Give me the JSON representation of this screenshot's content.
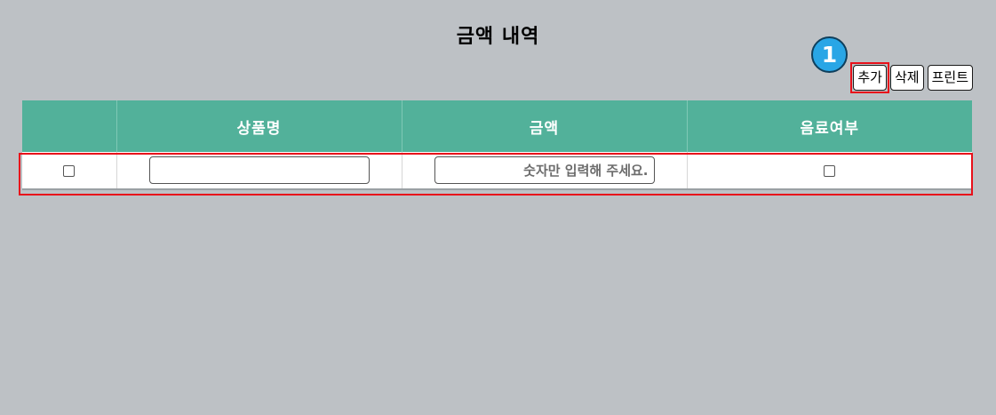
{
  "page": {
    "title": "금액 내역"
  },
  "toolbar": {
    "add_label": "추가",
    "delete_label": "삭제",
    "print_label": "프린트"
  },
  "annotation": {
    "step_number": "1"
  },
  "table": {
    "columns": [
      "",
      "상품명",
      "금액",
      "음료여부"
    ],
    "rows": [
      {
        "selected": false,
        "product_name": "",
        "amount": "",
        "amount_placeholder": "숫자만 입력해 주세요.",
        "is_beverage": false
      }
    ]
  },
  "colors": {
    "background": "#bdc1c5",
    "header": "#52b19a",
    "highlight": "#e8101a",
    "badge": "#29a6e6"
  }
}
